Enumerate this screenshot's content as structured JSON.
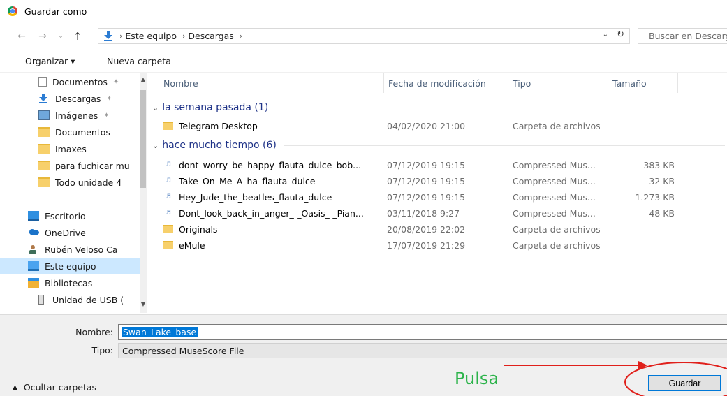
{
  "window": {
    "title": "Guardar como",
    "app_icon": "chrome-icon"
  },
  "nav": {
    "back_icon": "arrow-left-icon",
    "forward_icon": "arrow-right-icon",
    "recent_icon": "chevron-down-icon",
    "up_icon": "arrow-up-icon",
    "breadcrumbs": [
      "Este equipo",
      "Descargas"
    ],
    "search_placeholder": "Buscar en Descargas"
  },
  "toolbar": {
    "organize_label": "Organizar ▾",
    "new_folder_label": "Nueva carpeta"
  },
  "sidebar": {
    "items": [
      {
        "label": "Documentos",
        "icon": "documents-icon",
        "pinned": true
      },
      {
        "label": "Descargas",
        "icon": "downloads-icon",
        "pinned": true
      },
      {
        "label": "Imágenes",
        "icon": "pictures-icon",
        "pinned": true
      },
      {
        "label": "Documentos",
        "icon": "folder-icon"
      },
      {
        "label": "Imaxes",
        "icon": "folder-icon"
      },
      {
        "label": "para fuchicar mu",
        "icon": "folder-icon"
      },
      {
        "label": "Todo unidade 4",
        "icon": "folder-icon"
      },
      {
        "label": "Escritorio",
        "icon": "desktop-icon"
      },
      {
        "label": "OneDrive",
        "icon": "onedrive-icon"
      },
      {
        "label": "Rubén Veloso Ca",
        "icon": "user-icon"
      },
      {
        "label": "Este equipo",
        "icon": "computer-icon",
        "selected": true
      },
      {
        "label": "Bibliotecas",
        "icon": "libraries-icon"
      },
      {
        "label": "Unidad de USB (",
        "icon": "usb-drive-icon"
      }
    ]
  },
  "columns": {
    "name": "Nombre",
    "date": "Fecha de modificación",
    "type": "Tipo",
    "size": "Tamaño"
  },
  "groups": [
    {
      "label": "la semana pasada (1)",
      "files": [
        {
          "name": "Telegram Desktop",
          "date": "04/02/2020 21:00",
          "type": "Carpeta de archivos",
          "size": "",
          "icon": "folder-icon"
        }
      ]
    },
    {
      "label": "hace mucho tiempo (6)",
      "files": [
        {
          "name": "dont_worry_be_happy_flauta_dulce_bob...",
          "date": "07/12/2019 19:15",
          "type": "Compressed Mus...",
          "size": "383 KB",
          "icon": "musescore-file-icon"
        },
        {
          "name": "Take_On_Me_A_ha_flauta_dulce",
          "date": "07/12/2019 19:15",
          "type": "Compressed Mus...",
          "size": "32 KB",
          "icon": "musescore-file-icon"
        },
        {
          "name": "Hey_Jude_the_beatles_flauta_dulce",
          "date": "07/12/2019 19:15",
          "type": "Compressed Mus...",
          "size": "1.273 KB",
          "icon": "musescore-file-icon"
        },
        {
          "name": "Dont_look_back_in_anger_-_Oasis_-_Pian...",
          "date": "03/11/2018 9:27",
          "type": "Compressed Mus...",
          "size": "48 KB",
          "icon": "musescore-file-icon"
        },
        {
          "name": "Originals",
          "date": "20/08/2019 22:02",
          "type": "Carpeta de archivos",
          "size": "",
          "icon": "folder-icon"
        },
        {
          "name": "eMule",
          "date": "17/07/2019 21:29",
          "type": "Carpeta de archivos",
          "size": "",
          "icon": "folder-icon"
        }
      ]
    }
  ],
  "form": {
    "name_label": "Nombre:",
    "name_value": "Swan_Lake_base",
    "type_label": "Tipo:",
    "type_value": "Compressed MuseScore File"
  },
  "footer": {
    "hide_folders_label": "Ocultar carpetas",
    "save_label": "Guardar"
  },
  "annotation": {
    "text": "Pulsa",
    "text_color": "#2bb34a",
    "arrow_color": "#e0201b"
  }
}
